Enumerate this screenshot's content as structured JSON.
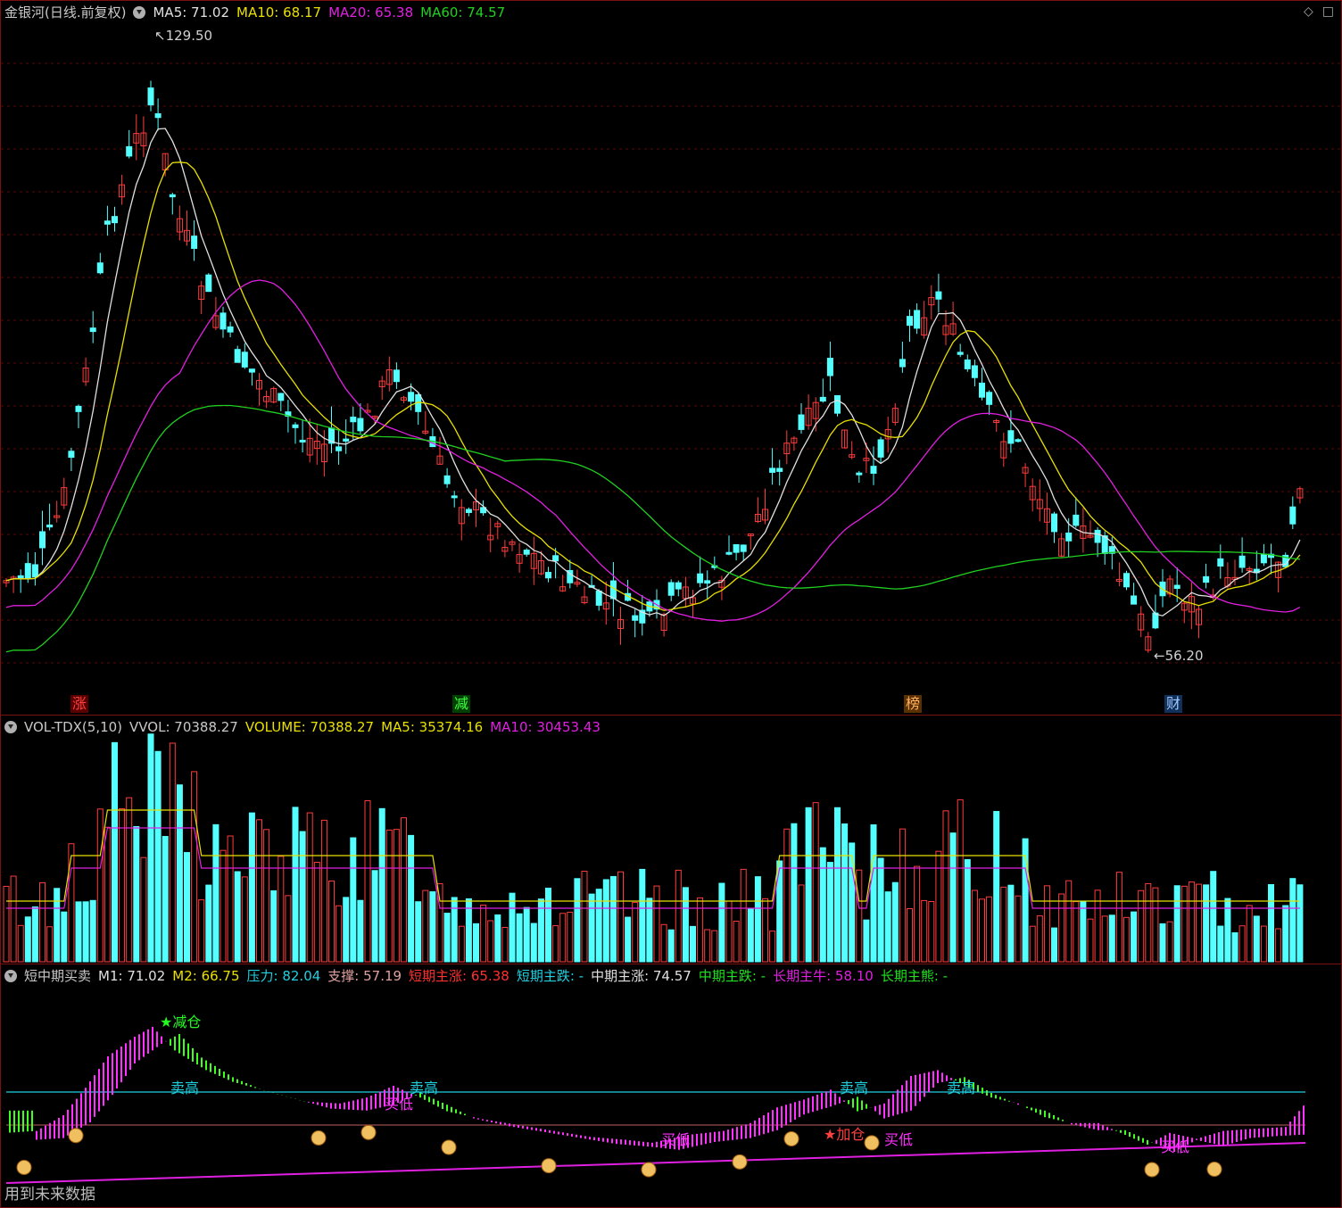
{
  "price_panel": {
    "title": "金银河(日线.前复权)",
    "indicators": [
      {
        "label": "MA5: 71.02",
        "color": "#e0e0e0"
      },
      {
        "label": "MA10: 68.17",
        "color": "#e8e000"
      },
      {
        "label": "MA20: 65.38",
        "color": "#e020e0"
      },
      {
        "label": "MA60: 74.57",
        "color": "#20d020"
      }
    ],
    "high_label": "129.50",
    "low_label": "56.20",
    "tags": [
      {
        "text": "涨",
        "color": "#ff4040",
        "bg": "#5a0000"
      },
      {
        "text": "减",
        "color": "#40ff40",
        "bg": "#004000"
      },
      {
        "text": "榜",
        "color": "#ffb060",
        "bg": "#5a3000"
      },
      {
        "text": "财",
        "color": "#a0c8ff",
        "bg": "#10305a"
      }
    ],
    "corner_icons": [
      "◇",
      "□"
    ]
  },
  "volume_panel": {
    "title": "VOL-TDX(5,10)",
    "indicators": [
      {
        "label": "VVOL: 70388.27",
        "color": "#c8c8c8"
      },
      {
        "label": "VOLUME: 70388.27",
        "color": "#e8e000"
      },
      {
        "label": "MA5: 35374.16",
        "color": "#e8e000"
      },
      {
        "label": "MA10: 30453.43",
        "color": "#e020e0"
      }
    ]
  },
  "indicator_panel": {
    "title": "短中期买卖",
    "indicators": [
      {
        "label": "M1: 71.02",
        "color": "#e0e0e0"
      },
      {
        "label": "M2: 66.75",
        "color": "#e8e000"
      },
      {
        "label": "压力: 82.04",
        "color": "#20d0e0"
      },
      {
        "label": "支撑: 57.19",
        "color": "#e0a0a0"
      },
      {
        "label": "短期主涨: 65.38",
        "color": "#ff3030"
      },
      {
        "label": "短期主跌: -",
        "color": "#20d0e0"
      },
      {
        "label": "中期主涨: 74.57",
        "color": "#e0e0e0"
      },
      {
        "label": "中期主跌: -",
        "color": "#20e020"
      },
      {
        "label": "长期主牛: 58.10",
        "color": "#e020e0"
      },
      {
        "label": "长期主熊: -",
        "color": "#20e020"
      }
    ],
    "signals": [
      {
        "text": "★减仓",
        "color": "#20ff20"
      },
      {
        "text": "卖高",
        "color": "#20d0e0"
      },
      {
        "text": "卖高",
        "color": "#20d0e0"
      },
      {
        "text": "卖高",
        "color": "#20d0e0"
      },
      {
        "text": "卖高",
        "color": "#20d0e0"
      },
      {
        "text": "买低",
        "color": "#ff30ff"
      },
      {
        "text": "买低",
        "color": "#ff30ff"
      },
      {
        "text": "买低",
        "color": "#ff30ff"
      },
      {
        "text": "★加仓",
        "color": "#ff4040"
      },
      {
        "text": "买低",
        "color": "#ff30ff"
      }
    ],
    "footer": "用到未来数据"
  },
  "colors": {
    "up": "#ff3c3c",
    "down": "#54ffff",
    "grid": "#5a0a0a"
  }
}
